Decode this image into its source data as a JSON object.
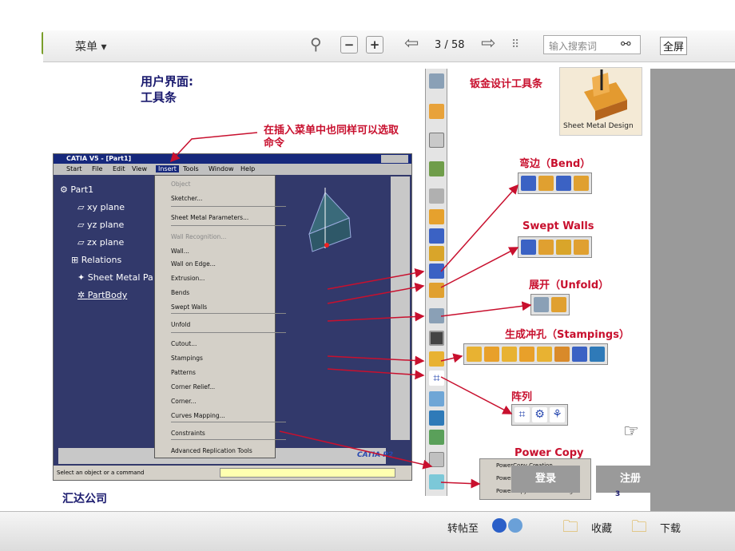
{
  "viewer": {
    "menu_label": "菜单",
    "page_current": "3",
    "page_sep": "/",
    "page_total": "58",
    "search_placeholder": "输入搜索词",
    "fullscreen_label": "全屏"
  },
  "slide": {
    "heading_line1": "用户界面:",
    "heading_line2": "工具条",
    "insert_note_line1": "在插入菜单中也同样可以选取",
    "insert_note_line2": "命令",
    "sheetmetal_title": "钣金设计工具条",
    "sheetmetal_logo_caption": "Sheet Metal Design",
    "bend_label": "弯边（Bend）",
    "swept_label": "Swept Walls",
    "unfold_label": "展开（Unfold）",
    "stamping_label": "生成冲孔（Stampings）",
    "array_label": "阵列",
    "powercopy_label": "Power Copy",
    "company": "汇达公司",
    "page_num": "3"
  },
  "catia": {
    "title": "CATIA V5 - [Part1]",
    "menu": [
      "Start",
      "File",
      "Edit",
      "View",
      "Insert",
      "Tools",
      "Window",
      "Help"
    ],
    "tree": [
      "Part1",
      "xy plane",
      "yz plane",
      "zx plane",
      "Relations",
      "Sheet Metal Pa",
      "PartBody"
    ],
    "dropdown": [
      "Object",
      "Sketcher...",
      "Sheet Metal Parameters...",
      "Wall Recognition...",
      "Wall...",
      "Wall on Edge...",
      "Extrusion...",
      "Bends",
      "Swept Walls",
      "Unfold",
      "Cutout...",
      "Stampings",
      "Patterns",
      "Corner Relief...",
      "Corner...",
      "Curves Mapping...",
      "Constraints",
      "Advanced Replication Tools"
    ],
    "status": "Select an object or a command",
    "brand": "CATIA P2",
    "powercopy_menu": [
      "PowerCopy Creation...",
      "PowerCopy Instantiation...",
      "PowerCopy Save in Catalog..."
    ]
  },
  "overlay": {
    "login_label": "登录",
    "register_label": "注册"
  },
  "bottom": {
    "share_label": "转帖至",
    "favorite_label": "收藏",
    "download_label": "下载"
  },
  "colors": {
    "accent_red": "#c8102e",
    "catia_bg": "#32396b",
    "overlay_gray": "#9a9a9a"
  }
}
